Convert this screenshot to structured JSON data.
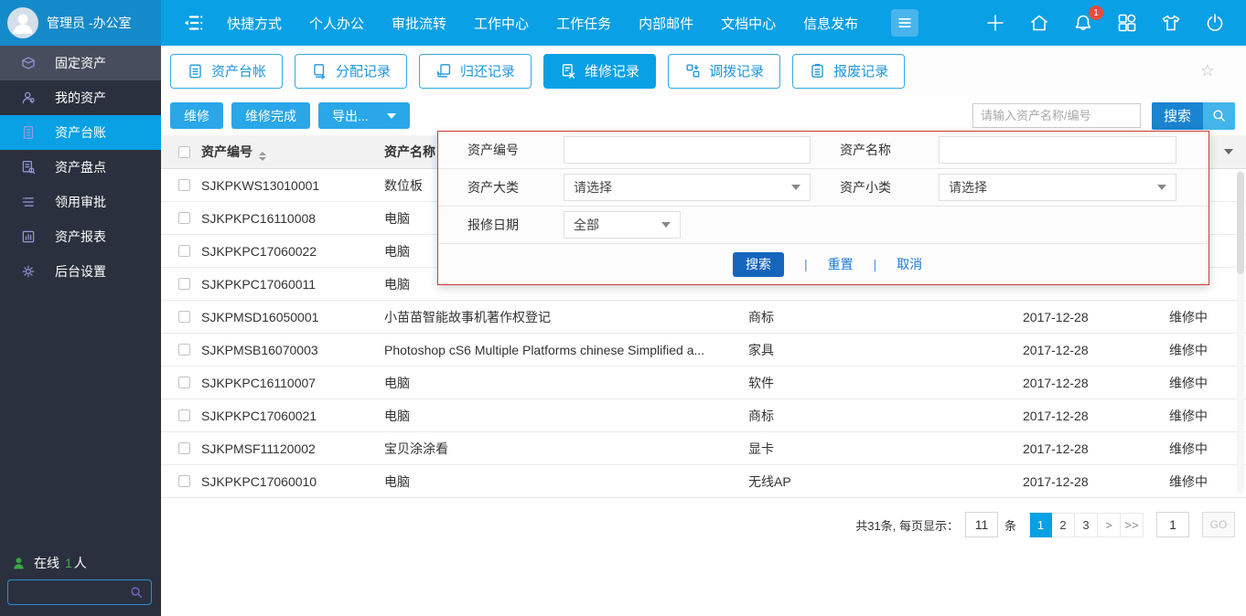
{
  "topbar": {
    "user": "管理员 -办公室",
    "nav": [
      "快捷方式",
      "个人办公",
      "审批流转",
      "工作中心",
      "工作任务",
      "内部邮件",
      "文档中心",
      "信息发布"
    ],
    "notification_count": "1"
  },
  "sidebar": {
    "items": [
      {
        "label": "固定资产"
      },
      {
        "label": "我的资产"
      },
      {
        "label": "资产台账"
      },
      {
        "label": "资产盘点"
      },
      {
        "label": "领用审批"
      },
      {
        "label": "资产报表"
      },
      {
        "label": "后台设置"
      }
    ],
    "online_label": "在线",
    "online_count": "1",
    "online_unit": "人"
  },
  "tabs": [
    {
      "label": "资产台帐"
    },
    {
      "label": "分配记录"
    },
    {
      "label": "归还记录"
    },
    {
      "label": "维修记录"
    },
    {
      "label": "调拨记录"
    },
    {
      "label": "报废记录"
    }
  ],
  "toolbar": {
    "repair": "维修",
    "repair_done": "维修完成",
    "export": "导出...",
    "search_placeholder": "请输入资产名称/编号",
    "search": "搜索"
  },
  "filter": {
    "asset_code_label": "资产编号",
    "asset_name_label": "资产名称",
    "major_label": "资产大类",
    "minor_label": "资产小类",
    "date_label": "报修日期",
    "select_placeholder": "请选择",
    "date_value": "全部",
    "search": "搜索",
    "reset": "重置",
    "cancel": "取消"
  },
  "table": {
    "columns": {
      "code": "资产编号",
      "name": "资产名称",
      "category": "",
      "date": "",
      "status": ""
    },
    "rows": [
      {
        "code": "SJKPKWS13010001",
        "name": "数位板",
        "category": "",
        "date": "",
        "status": ""
      },
      {
        "code": "SJKPKPC16110008",
        "name": "电脑",
        "category": "",
        "date": "",
        "status": ""
      },
      {
        "code": "SJKPKPC17060022",
        "name": "电脑",
        "category": "",
        "date": "",
        "status": ""
      },
      {
        "code": "SJKPKPC17060011",
        "name": "电脑",
        "category": "",
        "date": "",
        "status": ""
      },
      {
        "code": "SJKPMSD16050001",
        "name": "小苗苗智能故事机著作权登记",
        "category": "商标",
        "date": "2017-12-28",
        "status": "维修中"
      },
      {
        "code": "SJKPMSB16070003",
        "name": "Photoshop cS6 Multiple Platforms chinese Simplified a...",
        "category": "家具",
        "date": "2017-12-28",
        "status": "维修中"
      },
      {
        "code": "SJKPKPC16110007",
        "name": "电脑",
        "category": "软件",
        "date": "2017-12-28",
        "status": "维修中"
      },
      {
        "code": "SJKPKPC17060021",
        "name": "电脑",
        "category": "商标",
        "date": "2017-12-28",
        "status": "维修中"
      },
      {
        "code": "SJKPMSF11120002",
        "name": "宝贝涂涂看",
        "category": "显卡",
        "date": "2017-12-28",
        "status": "维修中"
      },
      {
        "code": "SJKPKPC17060010",
        "name": "电脑",
        "category": "无线AP",
        "date": "2017-12-28",
        "status": "维修中"
      }
    ]
  },
  "pagination": {
    "summary": "共31条, 每页显示：",
    "page_size": "11",
    "unit": "条",
    "pages": [
      "1",
      "2",
      "3"
    ],
    "next": ">",
    "last": ">>",
    "jump_value": "1",
    "go": "GO"
  },
  "colors": {
    "topbar": "#09a0e6",
    "sidebar": "#2b303e",
    "accent": "#09a0e4",
    "popup_border": "#cf3b37"
  }
}
